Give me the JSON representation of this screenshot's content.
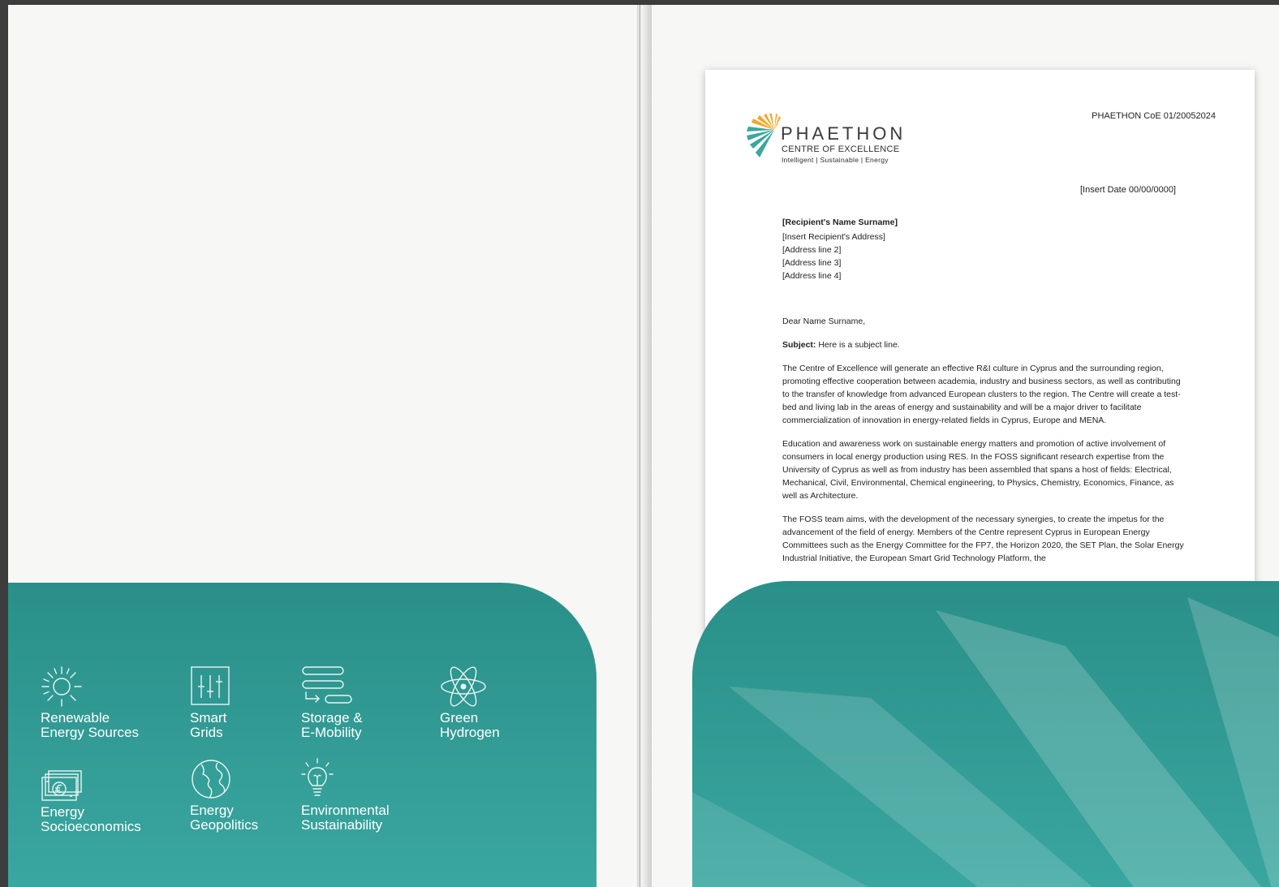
{
  "left_folder": {
    "research_areas": [
      {
        "icon": "sun-icon",
        "label": "Renewable\nEnergy Sources"
      },
      {
        "icon": "grid-controls-icon",
        "label": "Smart\nGrids"
      },
      {
        "icon": "storage-icon",
        "label": "Storage &\nE-Mobility"
      },
      {
        "icon": "atom-icon",
        "label": "Green\nHydrogen"
      },
      {
        "icon": "banknote-icon",
        "label": "Energy\nSocioeconomics"
      },
      {
        "icon": "globe-icon",
        "label": "Energy\nGeopolitics"
      },
      {
        "icon": "lightbulb-icon",
        "label": "Environmental\nSustainability"
      }
    ]
  },
  "letter": {
    "logo": {
      "name": "PHAETHON",
      "subtitle": "CENTRE OF EXCELLENCE",
      "tagline": "Intelligent | Sustainable | Energy"
    },
    "reference": "PHAETHON CoE 01/20052024",
    "date": "[Insert Date 00/00/0000]",
    "recipient": {
      "name": "[Recipient's Name Surname]",
      "address_lines": [
        "[Insert Recipient's Address]",
        "[Address line 2]",
        "[Address line 3]",
        "[Address line 4]"
      ]
    },
    "salutation": "Dear Name Surname,",
    "subject_label": "Subject:",
    "subject_text": "Here is a subject line.",
    "paragraphs": [
      "The Centre of Excellence will generate an effective R&I culture in Cyprus and the surrounding region, promoting effective cooperation between academia, industry and business sectors, as well as contributing to the transfer of knowledge from advanced European clusters to the region. The Centre will create a test-bed and living lab in the areas of energy and sustainability and will be a major driver to facilitate commercialization of innovation in energy-related fields in Cyprus, Europe and MENA.",
      "Education and awareness work on sustainable energy matters and promotion of active involvement of consumers in local energy production using RES. In the FOSS significant research expertise from the University of Cyprus as well as from industry has been assembled that spans a host of fields: Electrical, Mechanical, Civil, Environmental, Chemical engineering, to Physics, Chemistry, Economics, Finance, as well as Architecture.",
      "The FOSS team aims, with the development of the necessary synergies, to create the impetus for the advancement of the field of energy. Members of the Centre represent Cyprus in European Energy Committees such as the Energy Committee for the FP7, the Horizon 2020, the SET Plan, the Solar Energy Industrial Initiative, the European Smart Grid Technology Platform, the"
    ]
  },
  "colors": {
    "brand_teal": "#2a8f89",
    "brand_teal_light": "#3aa7a0",
    "logo_orange": "#f5a623"
  }
}
